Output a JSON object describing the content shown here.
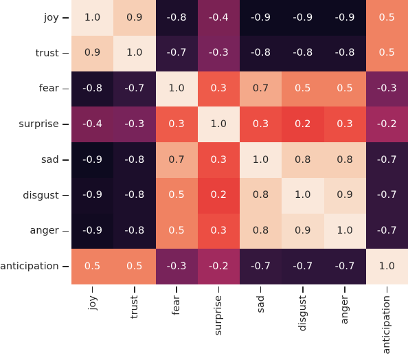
{
  "chart_data": {
    "type": "heatmap",
    "title": "",
    "xlabel": "",
    "ylabel": "",
    "colormap": "rocket_r",
    "annotated": true,
    "grid": false,
    "legend": "none",
    "vmin": -1.0,
    "vmax": 1.0,
    "categories": [
      "joy",
      "trust",
      "fear",
      "surprise",
      "sad",
      "disgust",
      "anger",
      "anticipation"
    ],
    "x_tick_labels": [
      "joy",
      "trust",
      "fear",
      "surprise",
      "sad",
      "disgust",
      "anger",
      "anticipation"
    ],
    "y_tick_labels": [
      "joy",
      "trust",
      "fear",
      "surprise",
      "sad",
      "disgust",
      "anger",
      "anticipation"
    ],
    "x_tick_rotation": 90,
    "rows": [
      {
        "label": "joy",
        "values": [
          1.0,
          0.9,
          -0.8,
          -0.4,
          -0.9,
          -0.9,
          -0.9,
          0.5
        ],
        "text": [
          "1.0",
          "0.9",
          "-0.8",
          "-0.4",
          "-0.9",
          "-0.9",
          "-0.9",
          "0.5"
        ],
        "colors": [
          "#fae8db",
          "#f7cfb5",
          "#1c0e2b",
          "#7b2254",
          "#0d0a1f",
          "#0d0a1f",
          "#0d0a1f",
          "#f08262"
        ],
        "text_colors": [
          "#262626",
          "#262626",
          "#ffffff",
          "#ffffff",
          "#ffffff",
          "#ffffff",
          "#ffffff",
          "#ffffff"
        ]
      },
      {
        "label": "trust",
        "values": [
          0.9,
          1.0,
          -0.7,
          -0.3,
          -0.8,
          -0.8,
          -0.8,
          0.5
        ],
        "text": [
          "0.9",
          "1.0",
          "-0.7",
          "-0.3",
          "-0.8",
          "-0.8",
          "-0.8",
          "0.5"
        ],
        "colors": [
          "#f7cfb5",
          "#fae8db",
          "#31163c",
          "#78235a",
          "#1c0e2b",
          "#1c0e2b",
          "#1c0e2b",
          "#f08262"
        ],
        "text_colors": [
          "#262626",
          "#262626",
          "#ffffff",
          "#ffffff",
          "#ffffff",
          "#ffffff",
          "#ffffff",
          "#ffffff"
        ]
      },
      {
        "label": "fear",
        "values": [
          -0.8,
          -0.7,
          1.0,
          0.3,
          0.7,
          0.5,
          0.5,
          -0.3
        ],
        "text": [
          "-0.8",
          "-0.7",
          "1.0",
          "0.3",
          "0.7",
          "0.5",
          "0.5",
          "-0.3"
        ],
        "colors": [
          "#1c0e2b",
          "#31163c",
          "#fae8db",
          "#ee5b4a",
          "#f4a98a",
          "#f08262",
          "#f08262",
          "#78235a"
        ],
        "text_colors": [
          "#ffffff",
          "#ffffff",
          "#262626",
          "#ffffff",
          "#262626",
          "#ffffff",
          "#ffffff",
          "#ffffff"
        ]
      },
      {
        "label": "surprise",
        "values": [
          -0.4,
          -0.3,
          0.3,
          1.0,
          0.3,
          0.2,
          0.3,
          -0.2
        ],
        "text": [
          "-0.4",
          "-0.3",
          "0.3",
          "1.0",
          "0.3",
          "0.2",
          "0.3",
          "-0.2"
        ],
        "colors": [
          "#7b2254",
          "#78235a",
          "#ee5b4a",
          "#fae8db",
          "#ec4e43",
          "#e8413c",
          "#ec4e43",
          "#a12a5e"
        ],
        "text_colors": [
          "#ffffff",
          "#ffffff",
          "#ffffff",
          "#262626",
          "#ffffff",
          "#ffffff",
          "#ffffff",
          "#ffffff"
        ]
      },
      {
        "label": "sad",
        "values": [
          -0.9,
          -0.8,
          0.7,
          0.3,
          1.0,
          0.8,
          0.8,
          -0.7
        ],
        "text": [
          "-0.9",
          "-0.8",
          "0.7",
          "0.3",
          "1.0",
          "0.8",
          "0.8",
          "-0.7"
        ],
        "colors": [
          "#0d0a1f",
          "#1c0e2b",
          "#f4a98a",
          "#ec4e43",
          "#fae8db",
          "#f7cfb5",
          "#f7cfb5",
          "#34173d"
        ],
        "text_colors": [
          "#ffffff",
          "#ffffff",
          "#262626",
          "#ffffff",
          "#262626",
          "#262626",
          "#262626",
          "#ffffff"
        ]
      },
      {
        "label": "disgust",
        "values": [
          -0.9,
          -0.8,
          0.5,
          0.2,
          0.8,
          1.0,
          0.9,
          -0.7
        ],
        "text": [
          "-0.9",
          "-0.8",
          "0.5",
          "0.2",
          "0.8",
          "1.0",
          "0.9",
          "-0.7"
        ],
        "colors": [
          "#150b24",
          "#1c0e2b",
          "#f08262",
          "#e8413c",
          "#f7cfb5",
          "#fae8db",
          "#f8dcc8",
          "#34173d"
        ],
        "text_colors": [
          "#ffffff",
          "#ffffff",
          "#ffffff",
          "#ffffff",
          "#262626",
          "#262626",
          "#262626",
          "#ffffff"
        ]
      },
      {
        "label": "anger",
        "values": [
          -0.9,
          -0.8,
          0.5,
          0.3,
          0.8,
          0.9,
          1.0,
          -0.7
        ],
        "text": [
          "-0.9",
          "-0.8",
          "0.5",
          "0.3",
          "0.8",
          "0.9",
          "1.0",
          "-0.7"
        ],
        "colors": [
          "#110a21",
          "#1c0e2b",
          "#f08262",
          "#ec4e43",
          "#f7cfb5",
          "#f8dcc8",
          "#fae8db",
          "#34173d"
        ],
        "text_colors": [
          "#ffffff",
          "#ffffff",
          "#ffffff",
          "#ffffff",
          "#262626",
          "#262626",
          "#262626",
          "#ffffff"
        ]
      },
      {
        "label": "anticipation",
        "values": [
          0.5,
          0.5,
          -0.3,
          -0.2,
          -0.7,
          -0.7,
          -0.7,
          1.0
        ],
        "text": [
          "0.5",
          "0.5",
          "-0.3",
          "-0.2",
          "-0.7",
          "-0.7",
          "-0.7",
          "1.0"
        ],
        "colors": [
          "#f08262",
          "#f08262",
          "#78235a",
          "#a12a5e",
          "#34173d",
          "#2e153a",
          "#2e153a",
          "#fae8db"
        ],
        "text_colors": [
          "#ffffff",
          "#ffffff",
          "#ffffff",
          "#ffffff",
          "#ffffff",
          "#ffffff",
          "#ffffff",
          "#262626"
        ]
      }
    ]
  }
}
